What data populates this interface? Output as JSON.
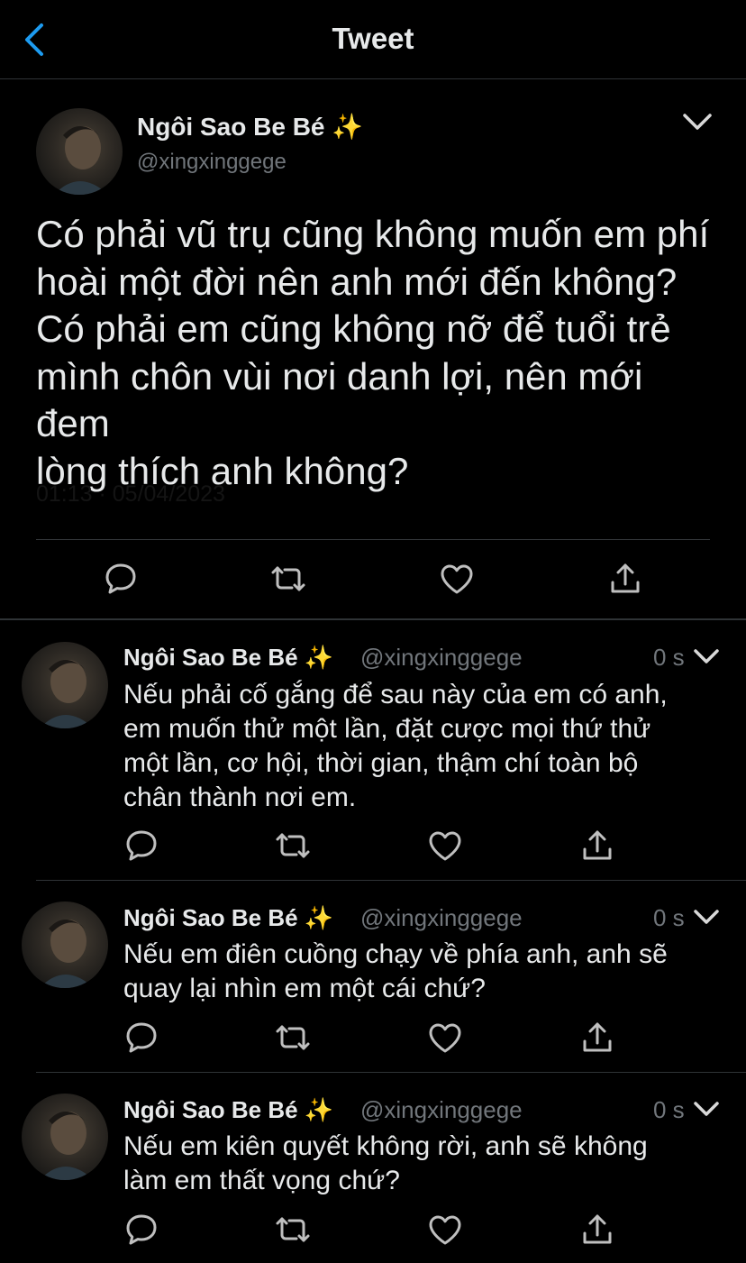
{
  "header": {
    "title": "Tweet",
    "back_icon": "chevron-left-icon",
    "accent": "#1d9bf0"
  },
  "main_tweet": {
    "author_name": "Ngôi Sao Be Bé ✨",
    "handle": "@xingxinggege",
    "text": "Có phải vũ trụ cũng không muốn em phí\nhoài một đời nên anh mới đến không?\nCó phải em cũng không nỡ để tuổi trẻ\nmình chôn vùi nơi danh lợi, nên mới đem\nlòng thích anh không?",
    "timestamp": "01:13 · 05/04/2023",
    "actions": [
      "reply-icon",
      "retweet-icon",
      "like-icon",
      "share-icon"
    ]
  },
  "replies": [
    {
      "author_name": "Ngôi Sao Be Bé ✨",
      "handle": "@xingxinggege",
      "time": "0 s",
      "text": "Nếu phải cố gắng để sau này của em có anh,\nem muốn thử một lần, đặt cược mọi thứ thử\nmột lần, cơ hội, thời gian, thậm chí toàn bộ\nchân thành nơi em."
    },
    {
      "author_name": "Ngôi Sao Be Bé ✨",
      "handle": "@xingxinggege",
      "time": "0 s",
      "text": "Nếu em điên cuồng chạy về phía anh, anh sẽ\nquay lại nhìn em một cái chứ?"
    },
    {
      "author_name": "Ngôi Sao Be Bé ✨",
      "handle": "@xingxinggege",
      "time": "0 s",
      "text": "Nếu em kiên quyết không rời, anh sẽ không\nlàm em thất vọng chứ?"
    }
  ],
  "colors": {
    "background": "#000000",
    "text": "#e7e9ea",
    "secondary": "#71767b",
    "divider": "#2f3336"
  }
}
